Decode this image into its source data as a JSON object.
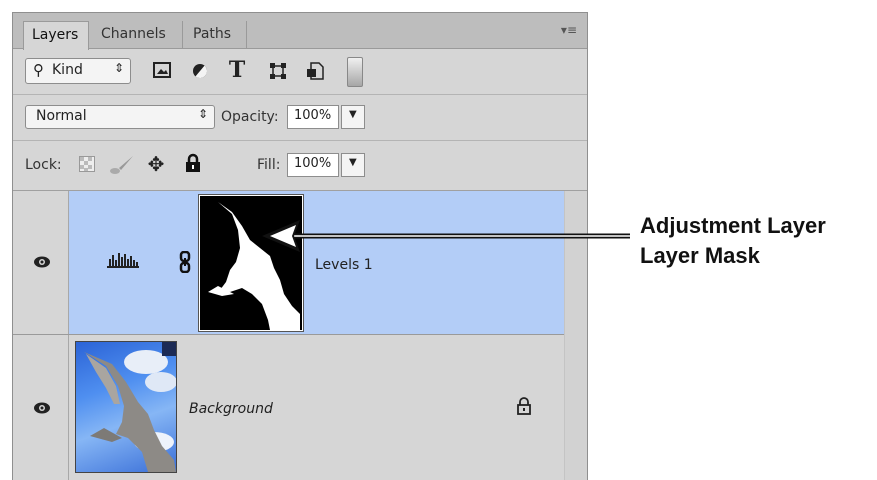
{
  "tabs": [
    {
      "label": "Layers",
      "active": true
    },
    {
      "label": "Channels",
      "active": false
    },
    {
      "label": "Paths",
      "active": false
    }
  ],
  "filter": {
    "kind_label": "Kind",
    "icons": [
      "image-filter-icon",
      "adjustment-filter-icon",
      "type-filter-icon",
      "shape-filter-icon",
      "smart-object-filter-icon"
    ]
  },
  "blend": {
    "mode": "Normal",
    "opacity_label": "Opacity:",
    "opacity_value": "100%"
  },
  "lock": {
    "label": "Lock:",
    "fill_label": "Fill:",
    "fill_value": "100%"
  },
  "layers": [
    {
      "name": "Levels 1",
      "selected": true,
      "type": "adjustment"
    },
    {
      "name": "Background",
      "selected": false,
      "type": "background",
      "locked": true
    }
  ],
  "annotation": {
    "line1": "Adjustment Layer",
    "line2": "Layer Mask"
  },
  "colors": {
    "selected_row": "#b3cdf7",
    "panel_bg": "#d6d6d6"
  }
}
